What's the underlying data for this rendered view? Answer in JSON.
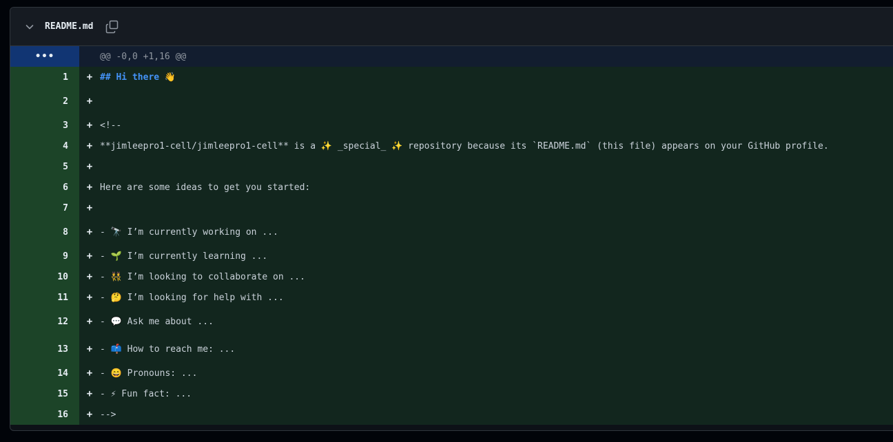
{
  "file": {
    "name": "README.md"
  },
  "hunk": {
    "expand_glyph": "•••",
    "header": "@@ -0,0 +1,16 @@"
  },
  "lines": [
    {
      "num": "1",
      "sign": "+",
      "text": "## Hi there 👋"
    },
    {
      "num": "2",
      "sign": "+",
      "text": ""
    },
    {
      "num": "3",
      "sign": "+",
      "text": "<!--"
    },
    {
      "num": "4",
      "sign": "+",
      "text": "**jimleepro1-cell/jimleepro1-cell** is a ✨ _special_ ✨ repository because its `README.md` (this file) appears on your GitHub profile."
    },
    {
      "num": "5",
      "sign": "+",
      "text": ""
    },
    {
      "num": "6",
      "sign": "+",
      "text": "Here are some ideas to get you started:"
    },
    {
      "num": "7",
      "sign": "+",
      "text": ""
    },
    {
      "num": "8",
      "sign": "+",
      "text": "- 🔭 I’m currently working on ..."
    },
    {
      "num": "9",
      "sign": "+",
      "text": "- 🌱 I’m currently learning ..."
    },
    {
      "num": "10",
      "sign": "+",
      "text": "- 👯 I’m looking to collaborate on ..."
    },
    {
      "num": "11",
      "sign": "+",
      "text": "- 🤔 I’m looking for help with ..."
    },
    {
      "num": "12",
      "sign": "+",
      "text": "- 💬 Ask me about ..."
    },
    {
      "num": "13",
      "sign": "+",
      "text": "- 📫 How to reach me: ..."
    },
    {
      "num": "14",
      "sign": "+",
      "text": "- 😄 Pronouns: ..."
    },
    {
      "num": "15",
      "sign": "+",
      "text": "- ⚡ Fun fact: ..."
    },
    {
      "num": "16",
      "sign": "+",
      "text": "-->"
    }
  ],
  "colors": {
    "added_line_bg": "#12261e",
    "added_gutter_bg": "#1c4428",
    "hunk_gutter_bg": "#113573",
    "heading_text": "#4493f8"
  },
  "icons": {
    "collapse": "chevron-down-icon",
    "copy": "copy-icon"
  }
}
